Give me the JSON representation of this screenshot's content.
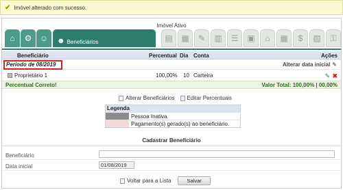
{
  "alert": {
    "icon": "check-icon",
    "message": "Imóvel alterado com sucesso."
  },
  "tabs": {
    "title": "Imóvel Ativo",
    "active_label": "Beneficiários",
    "left_icons": [
      "house-icon",
      "gear-icon",
      "people-icon"
    ],
    "right_icons": [
      "document-icon",
      "clipboard-icon",
      "tools-icon",
      "form-icon",
      "list-icon",
      "photo-icon",
      "home-icon",
      "calendar-icon",
      "money-icon",
      "book-icon",
      "key-icon"
    ]
  },
  "table": {
    "headers": {
      "beneficiario": "Beneficiário",
      "percentual": "Percentual",
      "dia": "Dia",
      "conta": "Conta",
      "acoes": "Ações"
    },
    "period": "Período de 08/2019",
    "alter_start": "Alterar data inicial",
    "rows": [
      {
        "name": "Proprietário 1",
        "percentual": "100,00%",
        "dia": "10",
        "conta": "Carteira"
      }
    ],
    "status_left": "Percentual Correto!",
    "status_right": "Valor Total: 100,00% | 00,00%"
  },
  "links": {
    "alterar": "Alterar Beneficiários",
    "editar": "Editar Percentuais"
  },
  "legend": {
    "title": "Legenda",
    "items": [
      {
        "color": "#8c8c8c",
        "label": "Pessoa Inativa."
      },
      {
        "color": "#f6dada",
        "label": "Pagamento(s) gerado(s) ao beneficiário."
      }
    ]
  },
  "form": {
    "section_title": "Cadastrar Beneficiário",
    "beneficiario_label": "Beneficiário",
    "beneficiario_value": "",
    "data_label": "Data inicial",
    "data_value": "01/08/2019"
  },
  "bottom": {
    "back_label": "Voltar para a Lista",
    "save_label": "Salvar"
  }
}
